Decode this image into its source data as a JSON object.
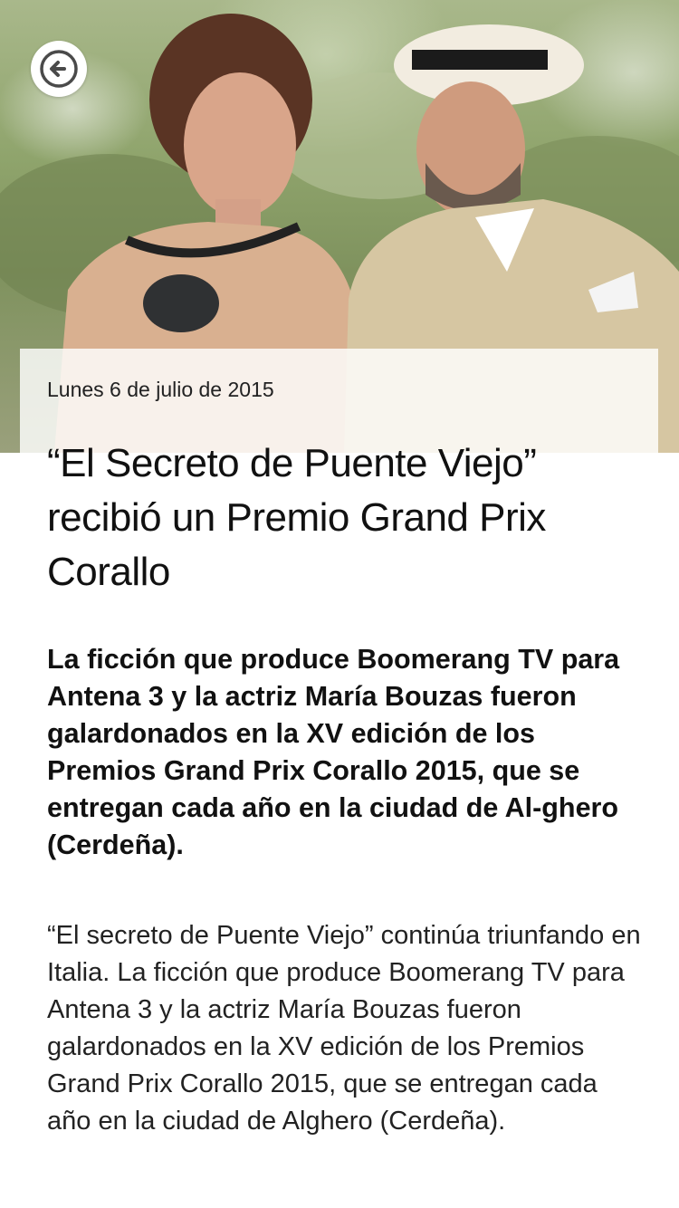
{
  "article": {
    "date": "Lunes 6 de julio de 2015",
    "title": "“El Secreto de Puente Viejo” recibió un Premio Grand Prix Corallo",
    "lead": "La ficción que produce Boomerang TV para Antena 3 y la actriz María Bouzas fueron galardonados en la XV edición de los Premios Grand Prix Corallo 2015, que se entregan cada año en la ciudad de Al-ghero (Cerdeña).",
    "body": "“El secreto de Puente Viejo” continúa triunfando en Italia. La ficción que produce Boomerang TV para Antena 3 y la actriz María Bouzas fueron galardonados en la XV edición de los Premios Grand Prix Corallo 2015, que se entregan cada año en la ciudad de Alghero (Cerdeña)."
  },
  "icons": {
    "back": "arrow-left-icon"
  },
  "colors": {
    "accent": "#4a4a4a",
    "background": "#ffffff"
  }
}
